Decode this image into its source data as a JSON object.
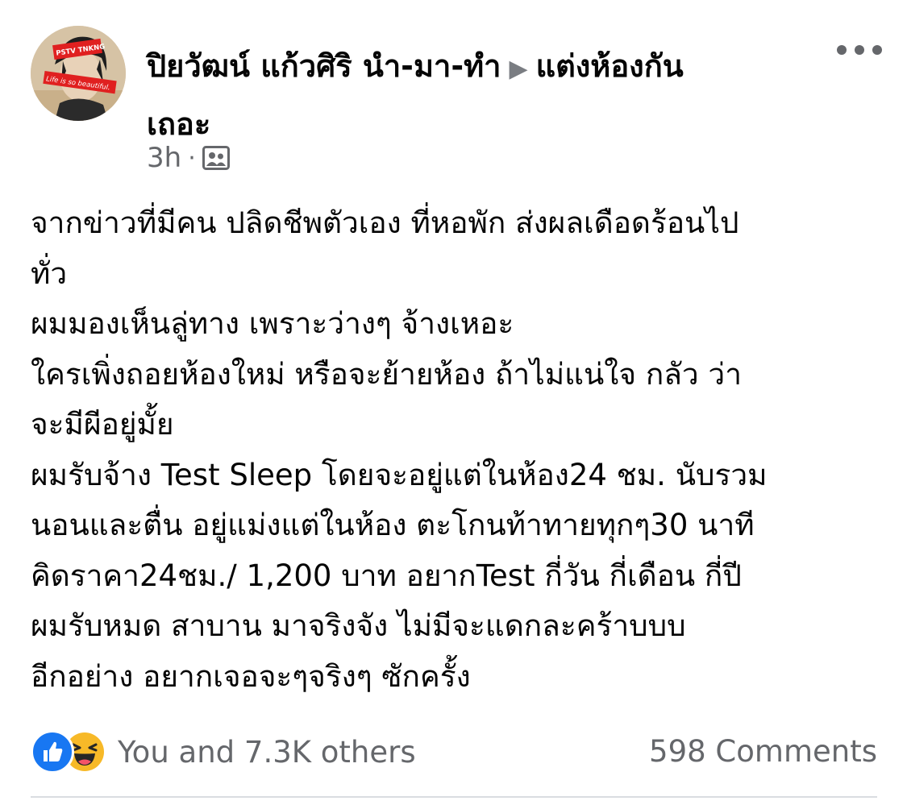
{
  "post": {
    "author": "ปิยวัฒน์ แก้วศิริ นำ-มา-ทำ",
    "group_line1": "แต่งห้องกัน",
    "group_line2": "เถอะ",
    "arrow": "▶",
    "time": "3h",
    "separator": "·",
    "avatar_text_top": "PSTV TNKNG",
    "avatar_text_bottom": "Life is so beautiful.",
    "more_icon": "more-horizontal-icon",
    "audience_icon": "group-icon"
  },
  "content": {
    "lines": [
      "จากข่าวที่มีคน ปลิดชีพตัวเอง ที่หอพัก ส่งผลเดือดร้อนไป",
      "ทั่ว",
      "ผมมองเห็นลู่ทาง เพราะว่างๆ จ้างเหอะ",
      "ใครเพิ่งถอยห้องใหม่ หรือจะย้ายห้อง ถ้าไม่แน่ใจ กลัว ว่า",
      "จะมีผีอยู่มั้ย",
      "ผมรับจ้าง Test Sleep โดยจะอยู่แต่ในห้อง24 ชม. นับรวม",
      "นอนและตื่น อยู่แม่งแต่ในห้อง ตะโกนท้าทายทุกๆ30 นาที",
      "คิดราคา24ชม./ 1,200 บาท  อยากTest กี่วัน กี่เดือน กี่ปี",
      "ผมรับหมด สาบาน มาจริงจัง ไม่มีจะแดกละคร้าบบบ",
      "อีกอย่าง อยากเจอจะๆจริงๆ ซักครั้ง"
    ]
  },
  "footer": {
    "reactions_text": "You and 7.3K others",
    "comments_text": "598 Comments",
    "reaction_icons": [
      "like-icon",
      "haha-icon"
    ],
    "colors": {
      "like": "#1877f2",
      "haha": "#f7b928",
      "secondary_text": "#65676b"
    }
  }
}
